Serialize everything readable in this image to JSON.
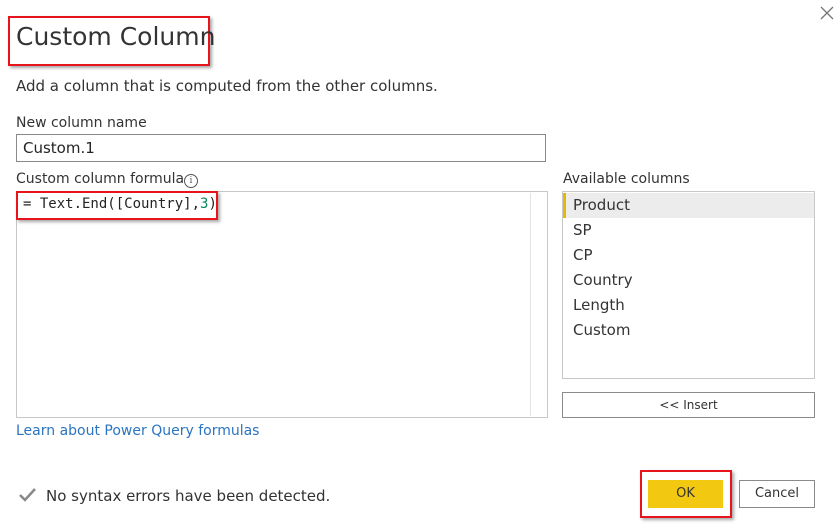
{
  "dialog": {
    "title": "Custom Column",
    "subtitle": "Add a column that is computed from the other columns.",
    "close_icon": "close-icon"
  },
  "new_column": {
    "label": "New column name",
    "value": "Custom.1"
  },
  "formula": {
    "label": "Custom column formula",
    "info_icon": "info-icon",
    "prefix": "= Text.End([Country],",
    "number": "3",
    "suffix": ")"
  },
  "available_columns": {
    "label": "Available columns",
    "items": [
      "Product",
      "SP",
      "CP",
      "Country",
      "Length",
      "Custom"
    ],
    "selected": "Product",
    "insert_label": "<< Insert"
  },
  "learn_link": "Learn about Power Query formulas",
  "status": {
    "icon": "check-icon",
    "text": "No syntax errors have been detected."
  },
  "buttons": {
    "ok": "OK",
    "cancel": "Cancel"
  },
  "colors": {
    "accent": "#f2c811",
    "highlight_border": "#e8141c",
    "link": "#2b74c1"
  }
}
